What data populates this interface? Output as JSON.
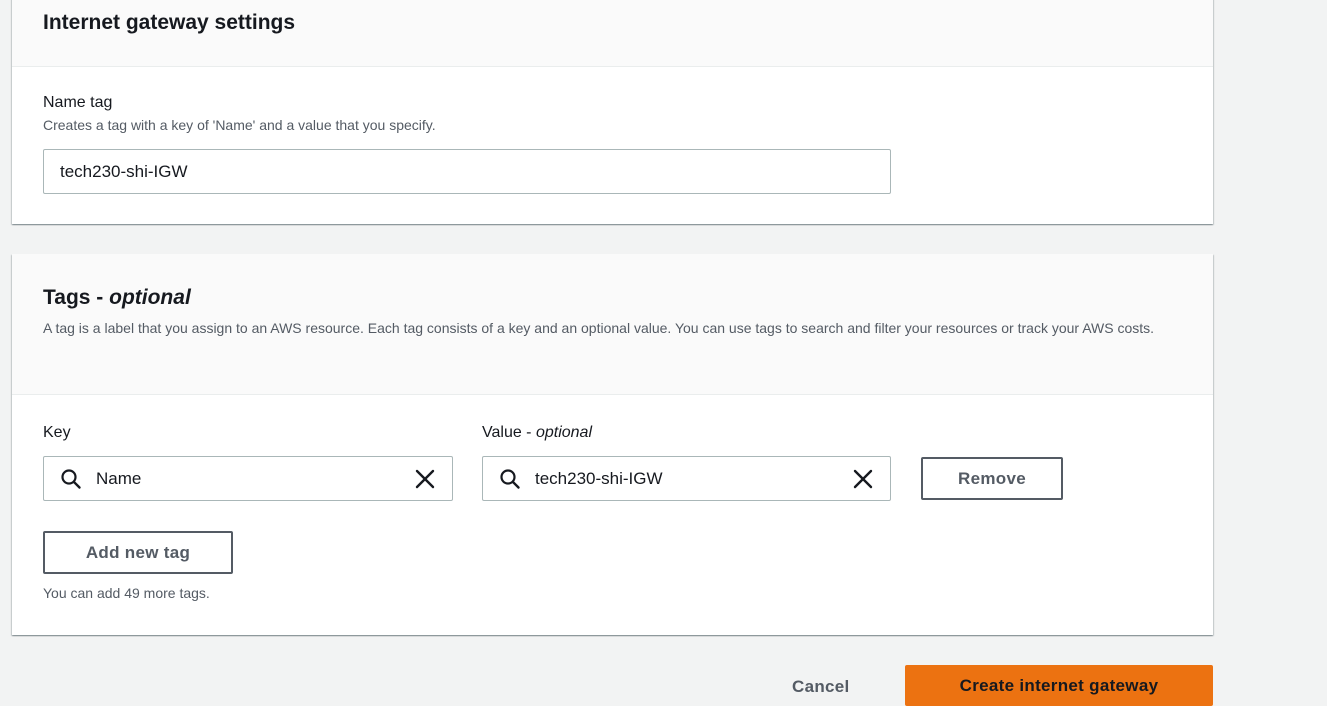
{
  "igw_settings": {
    "title": "Internet gateway settings",
    "name_tag_label": "Name tag",
    "name_tag_description": "Creates a tag with a key of 'Name' and a value that you specify.",
    "name_tag_value": "tech230-shi-IGW"
  },
  "tags": {
    "title": "Tags - ",
    "title_optional": "optional",
    "description": "A tag is a label that you assign to an AWS resource. Each tag consists of a key and an optional value. You can use tags to search and filter your resources or track your AWS costs.",
    "key_label": "Key",
    "value_label": "Value - ",
    "value_label_optional": "optional",
    "rows": [
      {
        "key": "Name",
        "value": "tech230-shi-IGW"
      }
    ],
    "remove_label": "Remove",
    "add_label": "Add new tag",
    "remaining_text": "You can add 49 more tags."
  },
  "footer": {
    "cancel_label": "Cancel",
    "create_label": "Create internet gateway"
  },
  "colors": {
    "primary_button": "#ec7211",
    "background": "#f2f3f3",
    "border": "#aab7b8"
  },
  "icons": {
    "search": "search-icon",
    "clear": "close-icon"
  }
}
